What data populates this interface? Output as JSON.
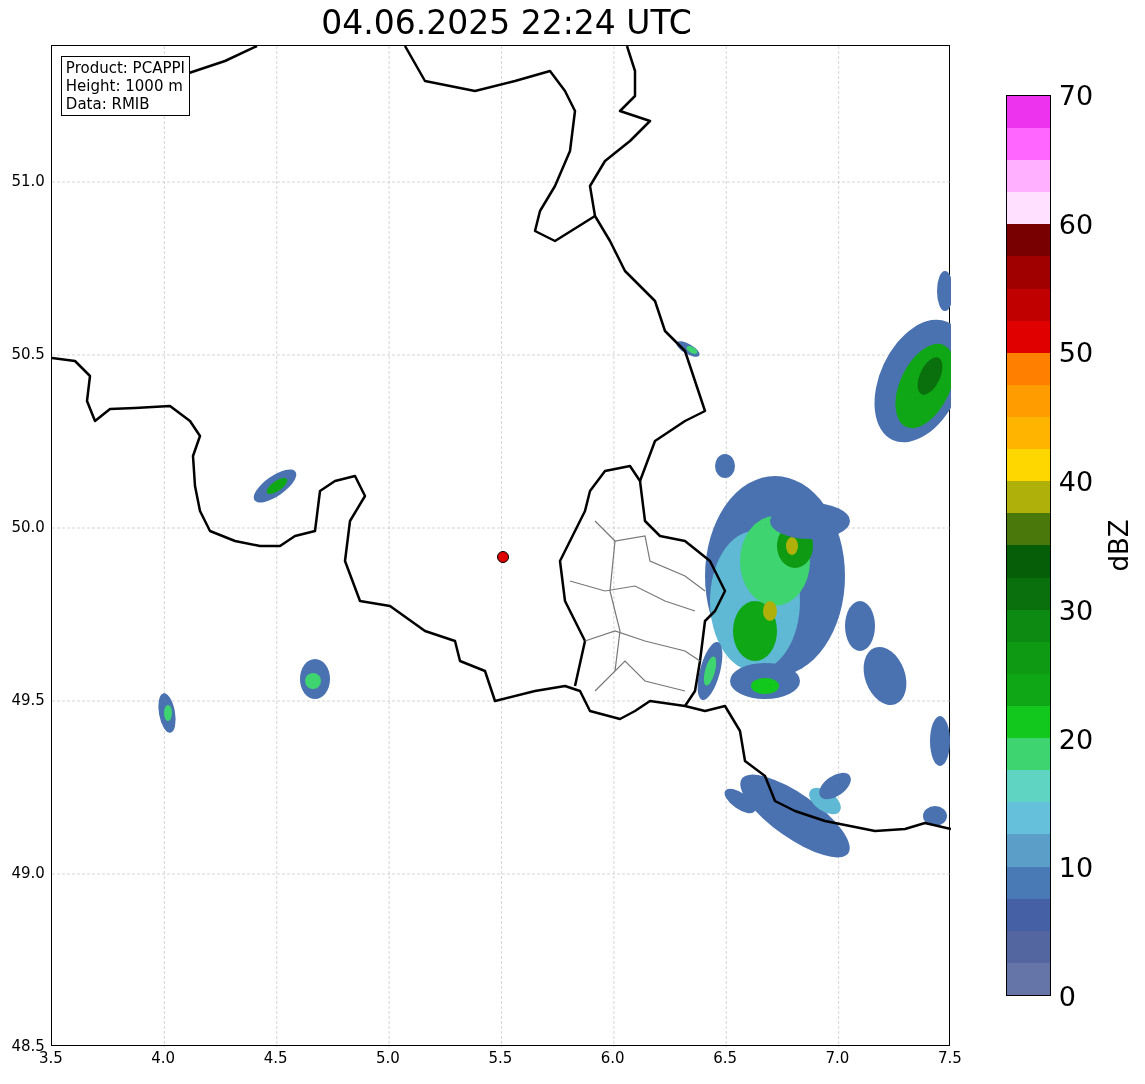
{
  "title": "04.06.2025 22:24 UTC",
  "info_box": [
    "Product: PCAPPI",
    "Height: 1000 m",
    "Data: RMIB"
  ],
  "map": {
    "xticks": [
      "3.5",
      "4.0",
      "4.5",
      "5.0",
      "5.5",
      "6.0",
      "6.5",
      "7.0",
      "7.5"
    ],
    "yticks": [
      "51.0",
      "50.5",
      "50.0",
      "49.5",
      "49.0",
      "48.5"
    ]
  },
  "colorbar": {
    "label": "dBZ",
    "ticks": [
      "70",
      "60",
      "50",
      "40",
      "30",
      "20",
      "10",
      "0"
    ],
    "segments": [
      {
        "color": "#6575a8"
      },
      {
        "color": "#5366a0"
      },
      {
        "color": "#4560a5"
      },
      {
        "color": "#4a7ab5"
      },
      {
        "color": "#5b9ec8"
      },
      {
        "color": "#65c0dc"
      },
      {
        "color": "#5fd4c2"
      },
      {
        "color": "#3ed470"
      },
      {
        "color": "#12c81c"
      },
      {
        "color": "#10a716"
      },
      {
        "color": "#0e9a12"
      },
      {
        "color": "#0c8a12"
      },
      {
        "color": "#0a700e"
      },
      {
        "color": "#075e09"
      },
      {
        "color": "#4a780a"
      },
      {
        "color": "#b0b00a"
      },
      {
        "color": "#ffd700"
      },
      {
        "color": "#ffb400"
      },
      {
        "color": "#ff9c00"
      },
      {
        "color": "#ff7f00"
      },
      {
        "color": "#e00000"
      },
      {
        "color": "#c00000"
      },
      {
        "color": "#a00000"
      },
      {
        "color": "#780000"
      },
      {
        "color": "#ffe0ff"
      },
      {
        "color": "#ffb0ff"
      },
      {
        "color": "#ff66ff"
      },
      {
        "color": "#ee33ee"
      }
    ]
  }
}
